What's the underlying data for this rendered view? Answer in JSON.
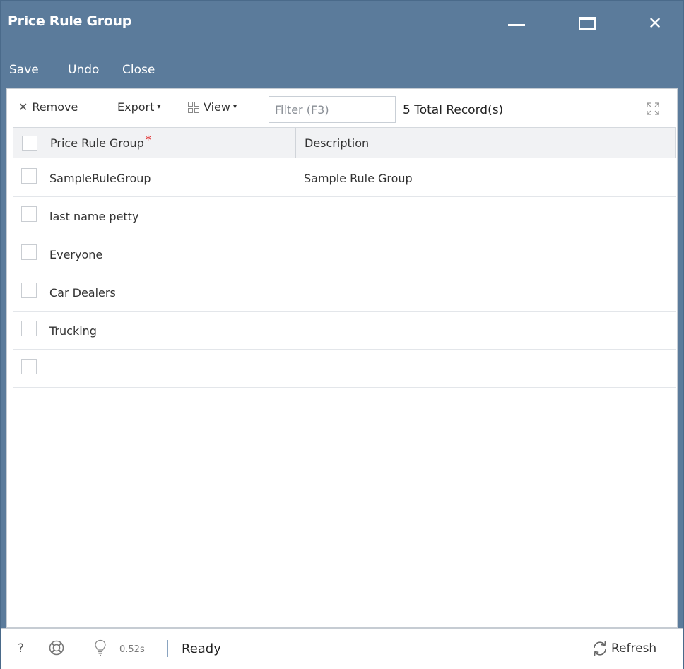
{
  "window": {
    "title": "Price Rule Group",
    "controls": {
      "minimize": "minimize-icon",
      "maximize": "maximize-icon",
      "close": "✕"
    }
  },
  "menu": {
    "items": [
      {
        "label": "Save"
      },
      {
        "label": "Undo"
      },
      {
        "label": "Close"
      }
    ]
  },
  "toolbar": {
    "remove_icon": "✕",
    "remove_label": "Remove",
    "export_label": "Export",
    "view_label": "View",
    "caret": "▾",
    "filter_placeholder": "Filter (F3)",
    "filter_value": "",
    "records_label": "5 Total Record(s)"
  },
  "grid": {
    "columns": [
      {
        "label": "Price Rule Group",
        "required": "*"
      },
      {
        "label": "Description"
      }
    ],
    "rows": [
      {
        "group": "SampleRuleGroup",
        "description": "Sample Rule Group"
      },
      {
        "group": "last name petty",
        "description": ""
      },
      {
        "group": "Everyone",
        "description": ""
      },
      {
        "group": "Car Dealers",
        "description": ""
      },
      {
        "group": "Trucking",
        "description": ""
      },
      {
        "group": "",
        "description": ""
      }
    ]
  },
  "status": {
    "help": "?",
    "time": "0.52s",
    "state": "Ready",
    "refresh_label": "Refresh"
  },
  "colors": {
    "window_chrome": "#5b7b9b",
    "required_star": "#e02020",
    "header_bg": "#f1f2f4"
  }
}
